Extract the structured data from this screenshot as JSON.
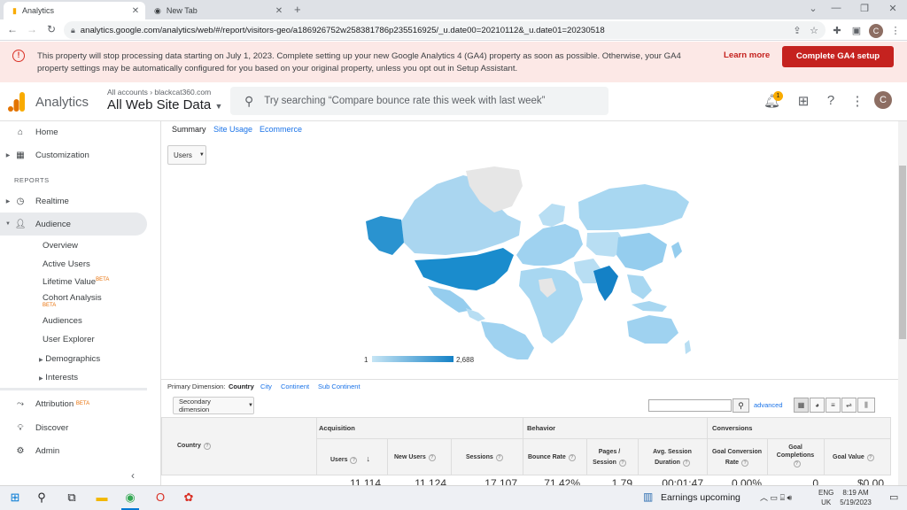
{
  "browser": {
    "tabs": [
      {
        "title": "Analytics",
        "icon": "analytics-favicon"
      },
      {
        "title": "New Tab",
        "icon": "chrome-favicon"
      }
    ],
    "new_tab": "+",
    "url": "analytics.google.com/analytics/web/#/report/visitors-geo/a186926752w258381786p235516925/_u.date00=20210112&_u.date01=20230518",
    "profile_initial": "C"
  },
  "banner": {
    "text": "This property will stop processing data starting on July 1, 2023. Complete setting up your new Google Analytics 4 (GA4) property as soon as possible. Otherwise, your GA4 property settings may be automatically configured for you based on your original property, unless you opt out in Setup Assistant.",
    "learn_more": "Learn more",
    "cta": "Complete GA4 setup",
    "icon": "alert-icon"
  },
  "header": {
    "app_name": "Analytics",
    "account_label": "All accounts › blackcat360.com",
    "view_name": "All Web Site Data",
    "search_placeholder": "Try searching “Compare bounce rate this week with last week”",
    "notif_count": "1",
    "avatar_initial": "C"
  },
  "sidebar": {
    "home": "Home",
    "customization": "Customization",
    "reports_label": "REPORTS",
    "realtime": "Realtime",
    "audience": "Audience",
    "sub": {
      "overview": "Overview",
      "active_users": "Active Users",
      "lifetime_value": "Lifetime Value",
      "lifetime_beta": "BETA",
      "cohort": "Cohort Analysis",
      "cohort_beta": "BETA",
      "audiences": "Audiences",
      "user_explorer": "User Explorer",
      "demographics": "Demographics",
      "interests": "Interests"
    },
    "attribution": "Attribution",
    "attribution_beta": "BETA",
    "discover": "Discover",
    "admin": "Admin"
  },
  "report": {
    "tabs": {
      "summary": "Summary",
      "site_usage": "Site Usage",
      "ecommerce": "Ecommerce"
    },
    "metric_select": "Users",
    "legend_min": "1",
    "legend_max": "2,688",
    "primary_dimension_label": "Primary Dimension:",
    "dimensions": {
      "country": "Country",
      "city": "City",
      "continent": "Continent",
      "sub_continent": "Sub Continent"
    },
    "secondary_dimension": "Secondary dimension",
    "advanced": "advanced",
    "table": {
      "country_col": "Country",
      "groups": {
        "acquisition": "Acquisition",
        "behavior": "Behavior",
        "conversions": "Conversions"
      },
      "cols": {
        "users": "Users",
        "new_users": "New Users",
        "sessions": "Sessions",
        "bounce_rate": "Bounce Rate",
        "pages_session": "Pages / Session",
        "avg_session": "Avg. Session Duration",
        "goal_conv": "Goal Conversion Rate",
        "goal_compl": "Goal Completions",
        "goal_value": "Goal Value"
      },
      "totals": {
        "users": "11,114",
        "new_users": "11,124",
        "sessions": "17,107",
        "bounce_rate": "71.42%",
        "pages_session": "1.79",
        "avg_session": "00:01:47",
        "goal_conv": "0.00%",
        "goal_compl": "0",
        "goal_value": "$0.00"
      }
    }
  },
  "taskbar": {
    "news": "Earnings upcoming",
    "lang_top": "ENG",
    "lang_bottom": "UK",
    "time": "8:19 AM",
    "date": "5/19/2023"
  },
  "colors": {
    "accent": "#1a73e8",
    "danger": "#c5221f",
    "map_high": "#1481c6",
    "map_low": "#c6e5f5"
  }
}
